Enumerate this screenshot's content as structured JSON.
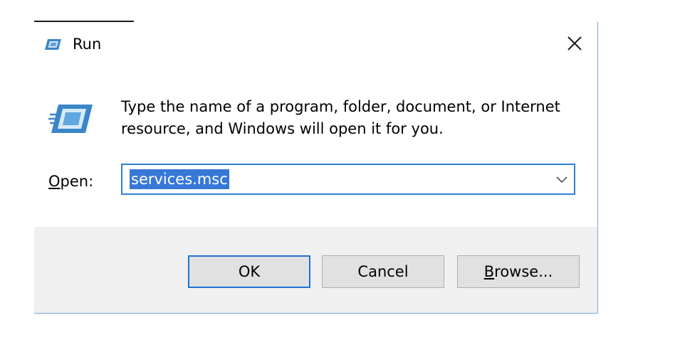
{
  "window": {
    "title": "Run",
    "icon": "run-icon",
    "close_icon": "close-icon"
  },
  "content": {
    "description": "Type the name of a program, folder, document, or Internet resource, and Windows will open it for you.",
    "open_label_mnemonic": "O",
    "open_label_rest": "pen:",
    "input_value": "services.msc",
    "dropdown_icon": "chevron-down-icon"
  },
  "buttons": {
    "ok": "OK",
    "cancel": "Cancel",
    "browse_mnemonic": "B",
    "browse_rest": "rowse..."
  },
  "colors": {
    "accent": "#2f7fd4",
    "selection": "#3778d7",
    "footer_bg": "#f0f0f0",
    "button_bg": "#e1e1e1"
  }
}
